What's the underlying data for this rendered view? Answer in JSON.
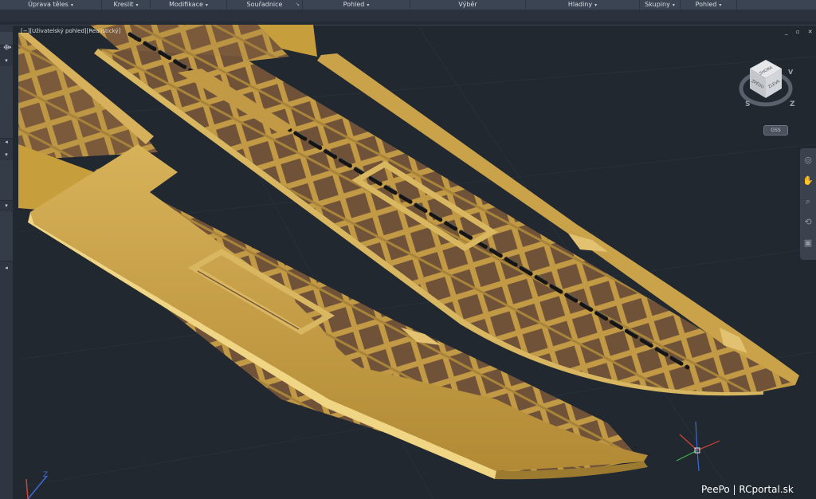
{
  "ribbon": {
    "panels": [
      {
        "label": "Úprava těles",
        "caret": true,
        "launcher": false
      },
      {
        "label": "Kreslit",
        "caret": true,
        "launcher": false
      },
      {
        "label": "Modifikace",
        "caret": true,
        "launcher": false
      },
      {
        "label": "Souřadnice",
        "caret": false,
        "launcher": true
      },
      {
        "label": "Pohled",
        "caret": true,
        "launcher": false
      },
      {
        "label": "Výběr",
        "caret": false,
        "launcher": false
      },
      {
        "label": "Hladiny",
        "caret": true,
        "launcher": false
      },
      {
        "label": "Skupiny",
        "caret": true,
        "launcher": false
      },
      {
        "label": "Pohled",
        "caret": true,
        "launcher": false
      }
    ]
  },
  "viewport": {
    "label": "[−][Uživatelský pohled][Realistický]",
    "visual_style": "Realistický",
    "window_controls": "_ ▫ ✕"
  },
  "viewcube": {
    "faces": {
      "top": "SHORA",
      "left": "ZPĚDU",
      "right": "ZLEVA"
    },
    "compass": {
      "south": "S",
      "west": "Z",
      "east": "V"
    },
    "wcs_label": "GSS"
  },
  "ucs": {
    "z_label": "Z"
  },
  "navbar": {
    "tools": [
      "steering-wheel-icon",
      "pan-icon",
      "zoom-icon",
      "orbit-icon",
      "showmotion-icon"
    ]
  },
  "watermark": "PeePo | RCportal.sk",
  "colors": {
    "background": "#212830",
    "wing_skin": "#c79e3c",
    "wing_skin_light": "#e8c970",
    "rib_wood": "#b48d3e",
    "covering": "#7b5a3c",
    "spar": "#151515"
  }
}
